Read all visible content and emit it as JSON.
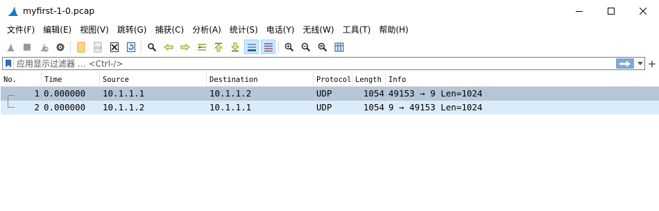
{
  "window": {
    "title": "myfirst-1-0.pcap"
  },
  "menu": [
    "文件(F)",
    "编辑(E)",
    "视图(V)",
    "跳转(G)",
    "捕获(C)",
    "分析(A)",
    "统计(S)",
    "电话(Y)",
    "无线(W)",
    "工具(T)",
    "帮助(H)"
  ],
  "toolbar": {
    "icons": [
      "start-capture-icon",
      "stop-capture-icon",
      "restart-capture-icon",
      "capture-options-icon",
      "open-file-icon",
      "save-file-icon",
      "close-file-icon",
      "reload-file-icon",
      "find-packet-icon",
      "go-back-icon",
      "go-forward-icon",
      "go-to-packet-icon",
      "first-packet-icon",
      "last-packet-icon",
      "autoscroll-icon",
      "colorize-icon",
      "zoom-in-icon",
      "zoom-out-icon",
      "normal-size-icon",
      "resize-columns-icon"
    ]
  },
  "filter": {
    "placeholder": "应用显示过滤器 … <Ctrl-/>"
  },
  "packet_list": {
    "columns": [
      "No.",
      "Time",
      "Source",
      "Destination",
      "Protocol",
      "Length",
      "Info"
    ],
    "rows": [
      {
        "no": "1",
        "time": "0.000000",
        "source": "10.1.1.1",
        "destination": "10.1.1.2",
        "protocol": "UDP",
        "length": "1054",
        "info": "49153 → 9  Len=1024",
        "state": "selected"
      },
      {
        "no": "2",
        "time": "0.000000",
        "source": "10.1.1.2",
        "destination": "10.1.1.1",
        "protocol": "UDP",
        "length": "1054",
        "info": "9 → 49153  Len=1024",
        "state": "related"
      }
    ]
  },
  "colors": {
    "selected_row": "#b5c7d6",
    "related_row": "#dcebf8",
    "apply_button": "#7fa8d8"
  }
}
